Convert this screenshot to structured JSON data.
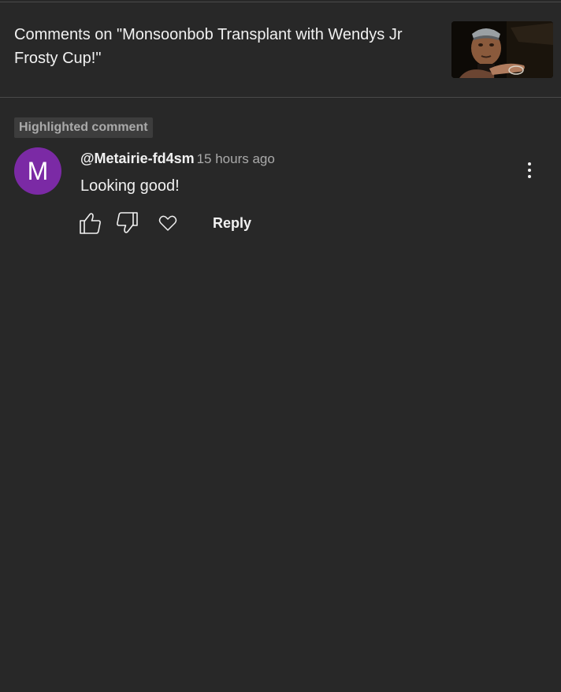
{
  "header": {
    "title": "Comments on \"Monsoonbob Transplant with Wendys Jr Frosty Cup!\""
  },
  "badge": {
    "label": "Highlighted comment"
  },
  "comment": {
    "avatar_letter": "M",
    "author": "@Metairie-fd4sm",
    "timestamp": "15 hours ago",
    "text": "Looking good!",
    "reply_label": "Reply"
  },
  "icons": {
    "like": "thumbs-up-icon",
    "dislike": "thumbs-down-icon",
    "heart": "heart-icon",
    "more": "more-vertical-icon"
  },
  "colors": {
    "background": "#282828",
    "avatar": "#7b2aa5",
    "badge_background": "#3d3d3d",
    "secondary_text": "#aaaaaa",
    "primary_text": "#f1f1f1"
  }
}
